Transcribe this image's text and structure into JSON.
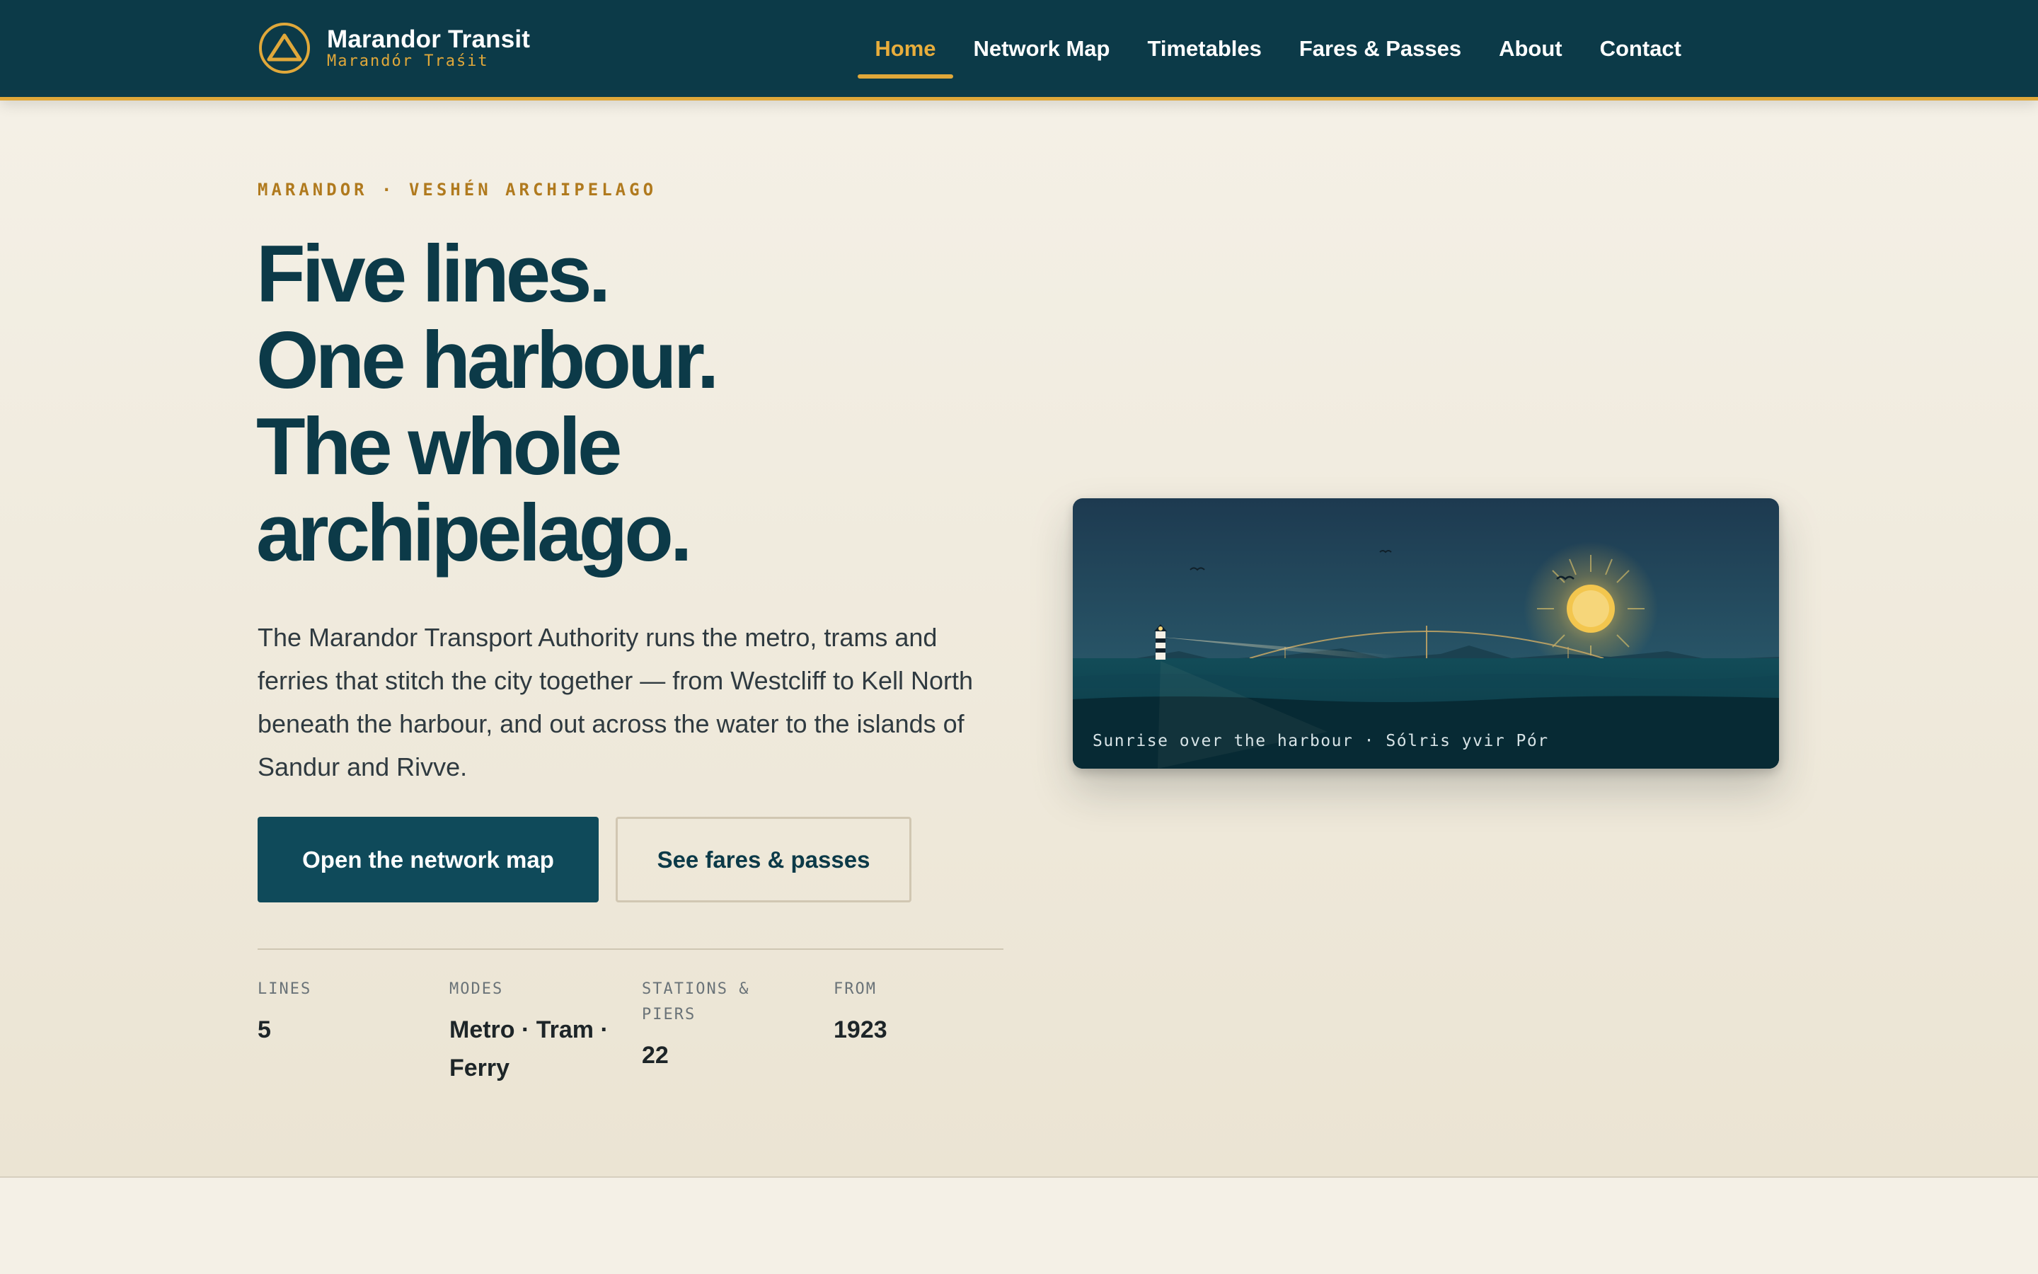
{
  "brand": {
    "name": "Marandor Transit",
    "subtitle": "Marandór Traśit",
    "logo_icon": "triangle-in-circle-icon",
    "accent_color": "#e0a83a",
    "primary_color": "#0c3a48"
  },
  "nav": {
    "items": [
      {
        "label": "Home",
        "active": true
      },
      {
        "label": "Network Map",
        "active": false
      },
      {
        "label": "Timetables",
        "active": false
      },
      {
        "label": "Fares & Passes",
        "active": false
      },
      {
        "label": "About",
        "active": false
      },
      {
        "label": "Contact",
        "active": false
      }
    ]
  },
  "hero": {
    "eyebrow": "MARANDOR · VESHÉN ARCHIPELAGO",
    "headline": [
      "Five lines.",
      "One harbour.",
      "The whole",
      "archipelago."
    ],
    "intro": "The Marandor Transport Authority runs the metro, trams and ferries that stitch the city together — from Westcliff to Kell North beneath the harbour, and out across the water to the islands of Sandur and Rivve.",
    "primary_button": "Open the network map",
    "secondary_button": "See fares & passes",
    "stats": [
      {
        "label": "LINES",
        "value": "5"
      },
      {
        "label": "MODES",
        "value": "Metro · Tram · Ferry"
      },
      {
        "label": "STATIONS & PIERS",
        "value": "22"
      },
      {
        "label": "FROM",
        "value": "1923"
      }
    ],
    "image_caption": "Sunrise over the harbour · Sólris yvir Pór"
  }
}
